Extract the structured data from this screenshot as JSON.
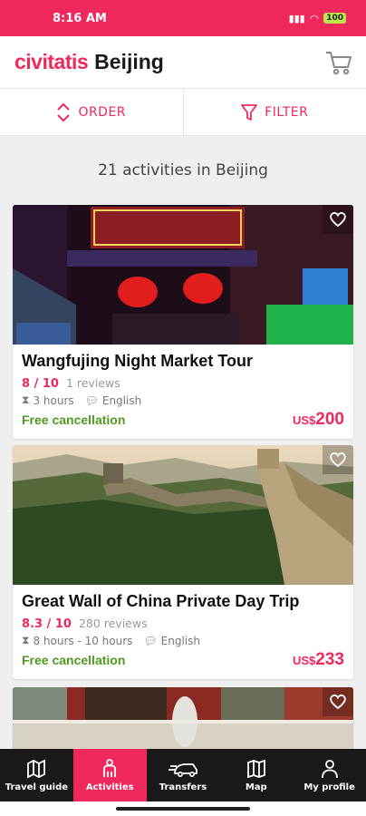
{
  "status_bar": {
    "time": "8:16 AM",
    "battery": "100"
  },
  "header": {
    "brand": "civitatis",
    "city": "Beijing"
  },
  "toolbar": {
    "order_label": "ORDER",
    "filter_label": "FILTER"
  },
  "activities_count": "21 activities in Beijing",
  "cards": [
    {
      "title": "Wangfujing Night Market Tour",
      "rating": "8 / 10",
      "reviews": "1 reviews",
      "duration": "3 hours",
      "language": "English",
      "cancellation": "Free cancellation",
      "currency": "US$",
      "price": "200"
    },
    {
      "title": "Great Wall of China Private Day Trip",
      "rating": "8.3 / 10",
      "reviews": "280  reviews",
      "duration": "8 hours -  10 hours",
      "language": "English",
      "cancellation": "Free cancellation",
      "currency": "US$",
      "price": "233"
    }
  ],
  "nav": [
    {
      "label": "Travel guide",
      "icon": "map-book-icon"
    },
    {
      "label": "Activities",
      "icon": "person-activities-icon"
    },
    {
      "label": "Transfers",
      "icon": "transfer-car-icon"
    },
    {
      "label": "Map",
      "icon": "map-icon"
    },
    {
      "label": "My profile",
      "icon": "profile-icon"
    }
  ],
  "colors": {
    "brand": "#f0295d",
    "free": "#4f9a1f",
    "nav_bg": "#1a1a1a"
  }
}
